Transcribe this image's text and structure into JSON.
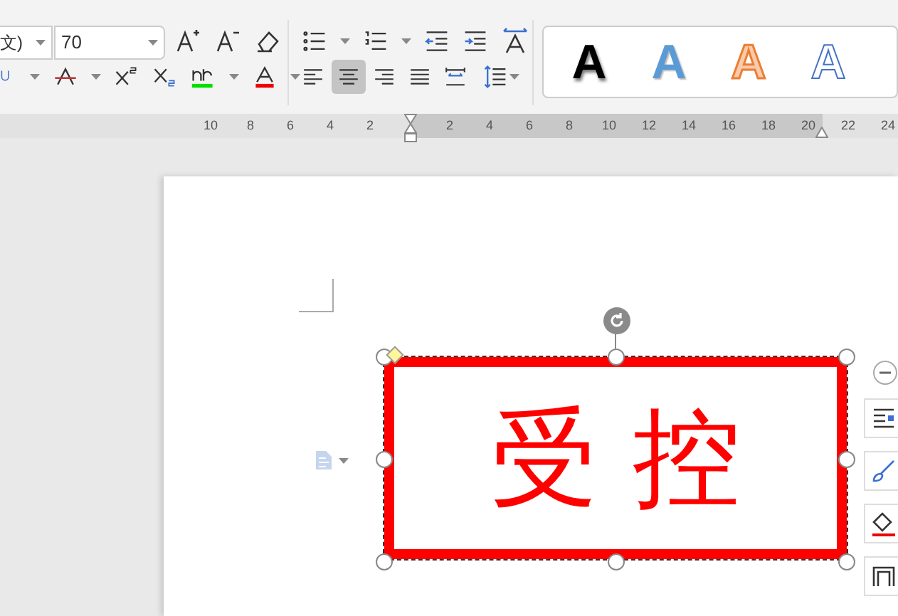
{
  "font": {
    "name": "文)",
    "size": "70"
  },
  "align_buttons": [
    {
      "kind": "left",
      "selected": false
    },
    {
      "kind": "center",
      "selected": true
    },
    {
      "kind": "right",
      "selected": false
    },
    {
      "kind": "justify",
      "selected": false
    },
    {
      "kind": "distribute",
      "selected": false
    }
  ],
  "text_styles": [
    {
      "label": "A",
      "kind": "black-shadow"
    },
    {
      "label": "A",
      "kind": "blue"
    },
    {
      "label": "A",
      "kind": "orange-outline"
    },
    {
      "label": "A",
      "kind": "blue-outline"
    }
  ],
  "ruler": {
    "left_numbers": [
      "10",
      "8",
      "6",
      "4",
      "2"
    ],
    "right_numbers": [
      "2",
      "4",
      "6",
      "8",
      "10",
      "12",
      "14",
      "16",
      "18",
      "20",
      "22",
      "24"
    ]
  },
  "text_box": {
    "text": "受 控"
  }
}
